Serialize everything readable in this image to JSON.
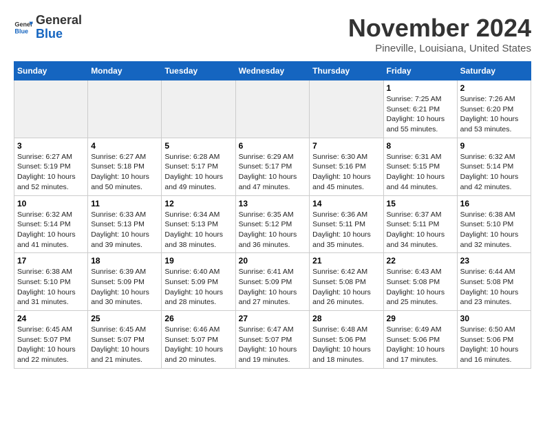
{
  "logo": {
    "text_general": "General",
    "text_blue": "Blue"
  },
  "title": "November 2024",
  "location": "Pineville, Louisiana, United States",
  "weekdays": [
    "Sunday",
    "Monday",
    "Tuesday",
    "Wednesday",
    "Thursday",
    "Friday",
    "Saturday"
  ],
  "weeks": [
    [
      {
        "day": "",
        "info": ""
      },
      {
        "day": "",
        "info": ""
      },
      {
        "day": "",
        "info": ""
      },
      {
        "day": "",
        "info": ""
      },
      {
        "day": "",
        "info": ""
      },
      {
        "day": "1",
        "info": "Sunrise: 7:25 AM\nSunset: 6:21 PM\nDaylight: 10 hours\nand 55 minutes."
      },
      {
        "day": "2",
        "info": "Sunrise: 7:26 AM\nSunset: 6:20 PM\nDaylight: 10 hours\nand 53 minutes."
      }
    ],
    [
      {
        "day": "3",
        "info": "Sunrise: 6:27 AM\nSunset: 5:19 PM\nDaylight: 10 hours\nand 52 minutes."
      },
      {
        "day": "4",
        "info": "Sunrise: 6:27 AM\nSunset: 5:18 PM\nDaylight: 10 hours\nand 50 minutes."
      },
      {
        "day": "5",
        "info": "Sunrise: 6:28 AM\nSunset: 5:17 PM\nDaylight: 10 hours\nand 49 minutes."
      },
      {
        "day": "6",
        "info": "Sunrise: 6:29 AM\nSunset: 5:17 PM\nDaylight: 10 hours\nand 47 minutes."
      },
      {
        "day": "7",
        "info": "Sunrise: 6:30 AM\nSunset: 5:16 PM\nDaylight: 10 hours\nand 45 minutes."
      },
      {
        "day": "8",
        "info": "Sunrise: 6:31 AM\nSunset: 5:15 PM\nDaylight: 10 hours\nand 44 minutes."
      },
      {
        "day": "9",
        "info": "Sunrise: 6:32 AM\nSunset: 5:14 PM\nDaylight: 10 hours\nand 42 minutes."
      }
    ],
    [
      {
        "day": "10",
        "info": "Sunrise: 6:32 AM\nSunset: 5:14 PM\nDaylight: 10 hours\nand 41 minutes."
      },
      {
        "day": "11",
        "info": "Sunrise: 6:33 AM\nSunset: 5:13 PM\nDaylight: 10 hours\nand 39 minutes."
      },
      {
        "day": "12",
        "info": "Sunrise: 6:34 AM\nSunset: 5:13 PM\nDaylight: 10 hours\nand 38 minutes."
      },
      {
        "day": "13",
        "info": "Sunrise: 6:35 AM\nSunset: 5:12 PM\nDaylight: 10 hours\nand 36 minutes."
      },
      {
        "day": "14",
        "info": "Sunrise: 6:36 AM\nSunset: 5:11 PM\nDaylight: 10 hours\nand 35 minutes."
      },
      {
        "day": "15",
        "info": "Sunrise: 6:37 AM\nSunset: 5:11 PM\nDaylight: 10 hours\nand 34 minutes."
      },
      {
        "day": "16",
        "info": "Sunrise: 6:38 AM\nSunset: 5:10 PM\nDaylight: 10 hours\nand 32 minutes."
      }
    ],
    [
      {
        "day": "17",
        "info": "Sunrise: 6:38 AM\nSunset: 5:10 PM\nDaylight: 10 hours\nand 31 minutes."
      },
      {
        "day": "18",
        "info": "Sunrise: 6:39 AM\nSunset: 5:09 PM\nDaylight: 10 hours\nand 30 minutes."
      },
      {
        "day": "19",
        "info": "Sunrise: 6:40 AM\nSunset: 5:09 PM\nDaylight: 10 hours\nand 28 minutes."
      },
      {
        "day": "20",
        "info": "Sunrise: 6:41 AM\nSunset: 5:09 PM\nDaylight: 10 hours\nand 27 minutes."
      },
      {
        "day": "21",
        "info": "Sunrise: 6:42 AM\nSunset: 5:08 PM\nDaylight: 10 hours\nand 26 minutes."
      },
      {
        "day": "22",
        "info": "Sunrise: 6:43 AM\nSunset: 5:08 PM\nDaylight: 10 hours\nand 25 minutes."
      },
      {
        "day": "23",
        "info": "Sunrise: 6:44 AM\nSunset: 5:08 PM\nDaylight: 10 hours\nand 23 minutes."
      }
    ],
    [
      {
        "day": "24",
        "info": "Sunrise: 6:45 AM\nSunset: 5:07 PM\nDaylight: 10 hours\nand 22 minutes."
      },
      {
        "day": "25",
        "info": "Sunrise: 6:45 AM\nSunset: 5:07 PM\nDaylight: 10 hours\nand 21 minutes."
      },
      {
        "day": "26",
        "info": "Sunrise: 6:46 AM\nSunset: 5:07 PM\nDaylight: 10 hours\nand 20 minutes."
      },
      {
        "day": "27",
        "info": "Sunrise: 6:47 AM\nSunset: 5:07 PM\nDaylight: 10 hours\nand 19 minutes."
      },
      {
        "day": "28",
        "info": "Sunrise: 6:48 AM\nSunset: 5:06 PM\nDaylight: 10 hours\nand 18 minutes."
      },
      {
        "day": "29",
        "info": "Sunrise: 6:49 AM\nSunset: 5:06 PM\nDaylight: 10 hours\nand 17 minutes."
      },
      {
        "day": "30",
        "info": "Sunrise: 6:50 AM\nSunset: 5:06 PM\nDaylight: 10 hours\nand 16 minutes."
      }
    ]
  ]
}
